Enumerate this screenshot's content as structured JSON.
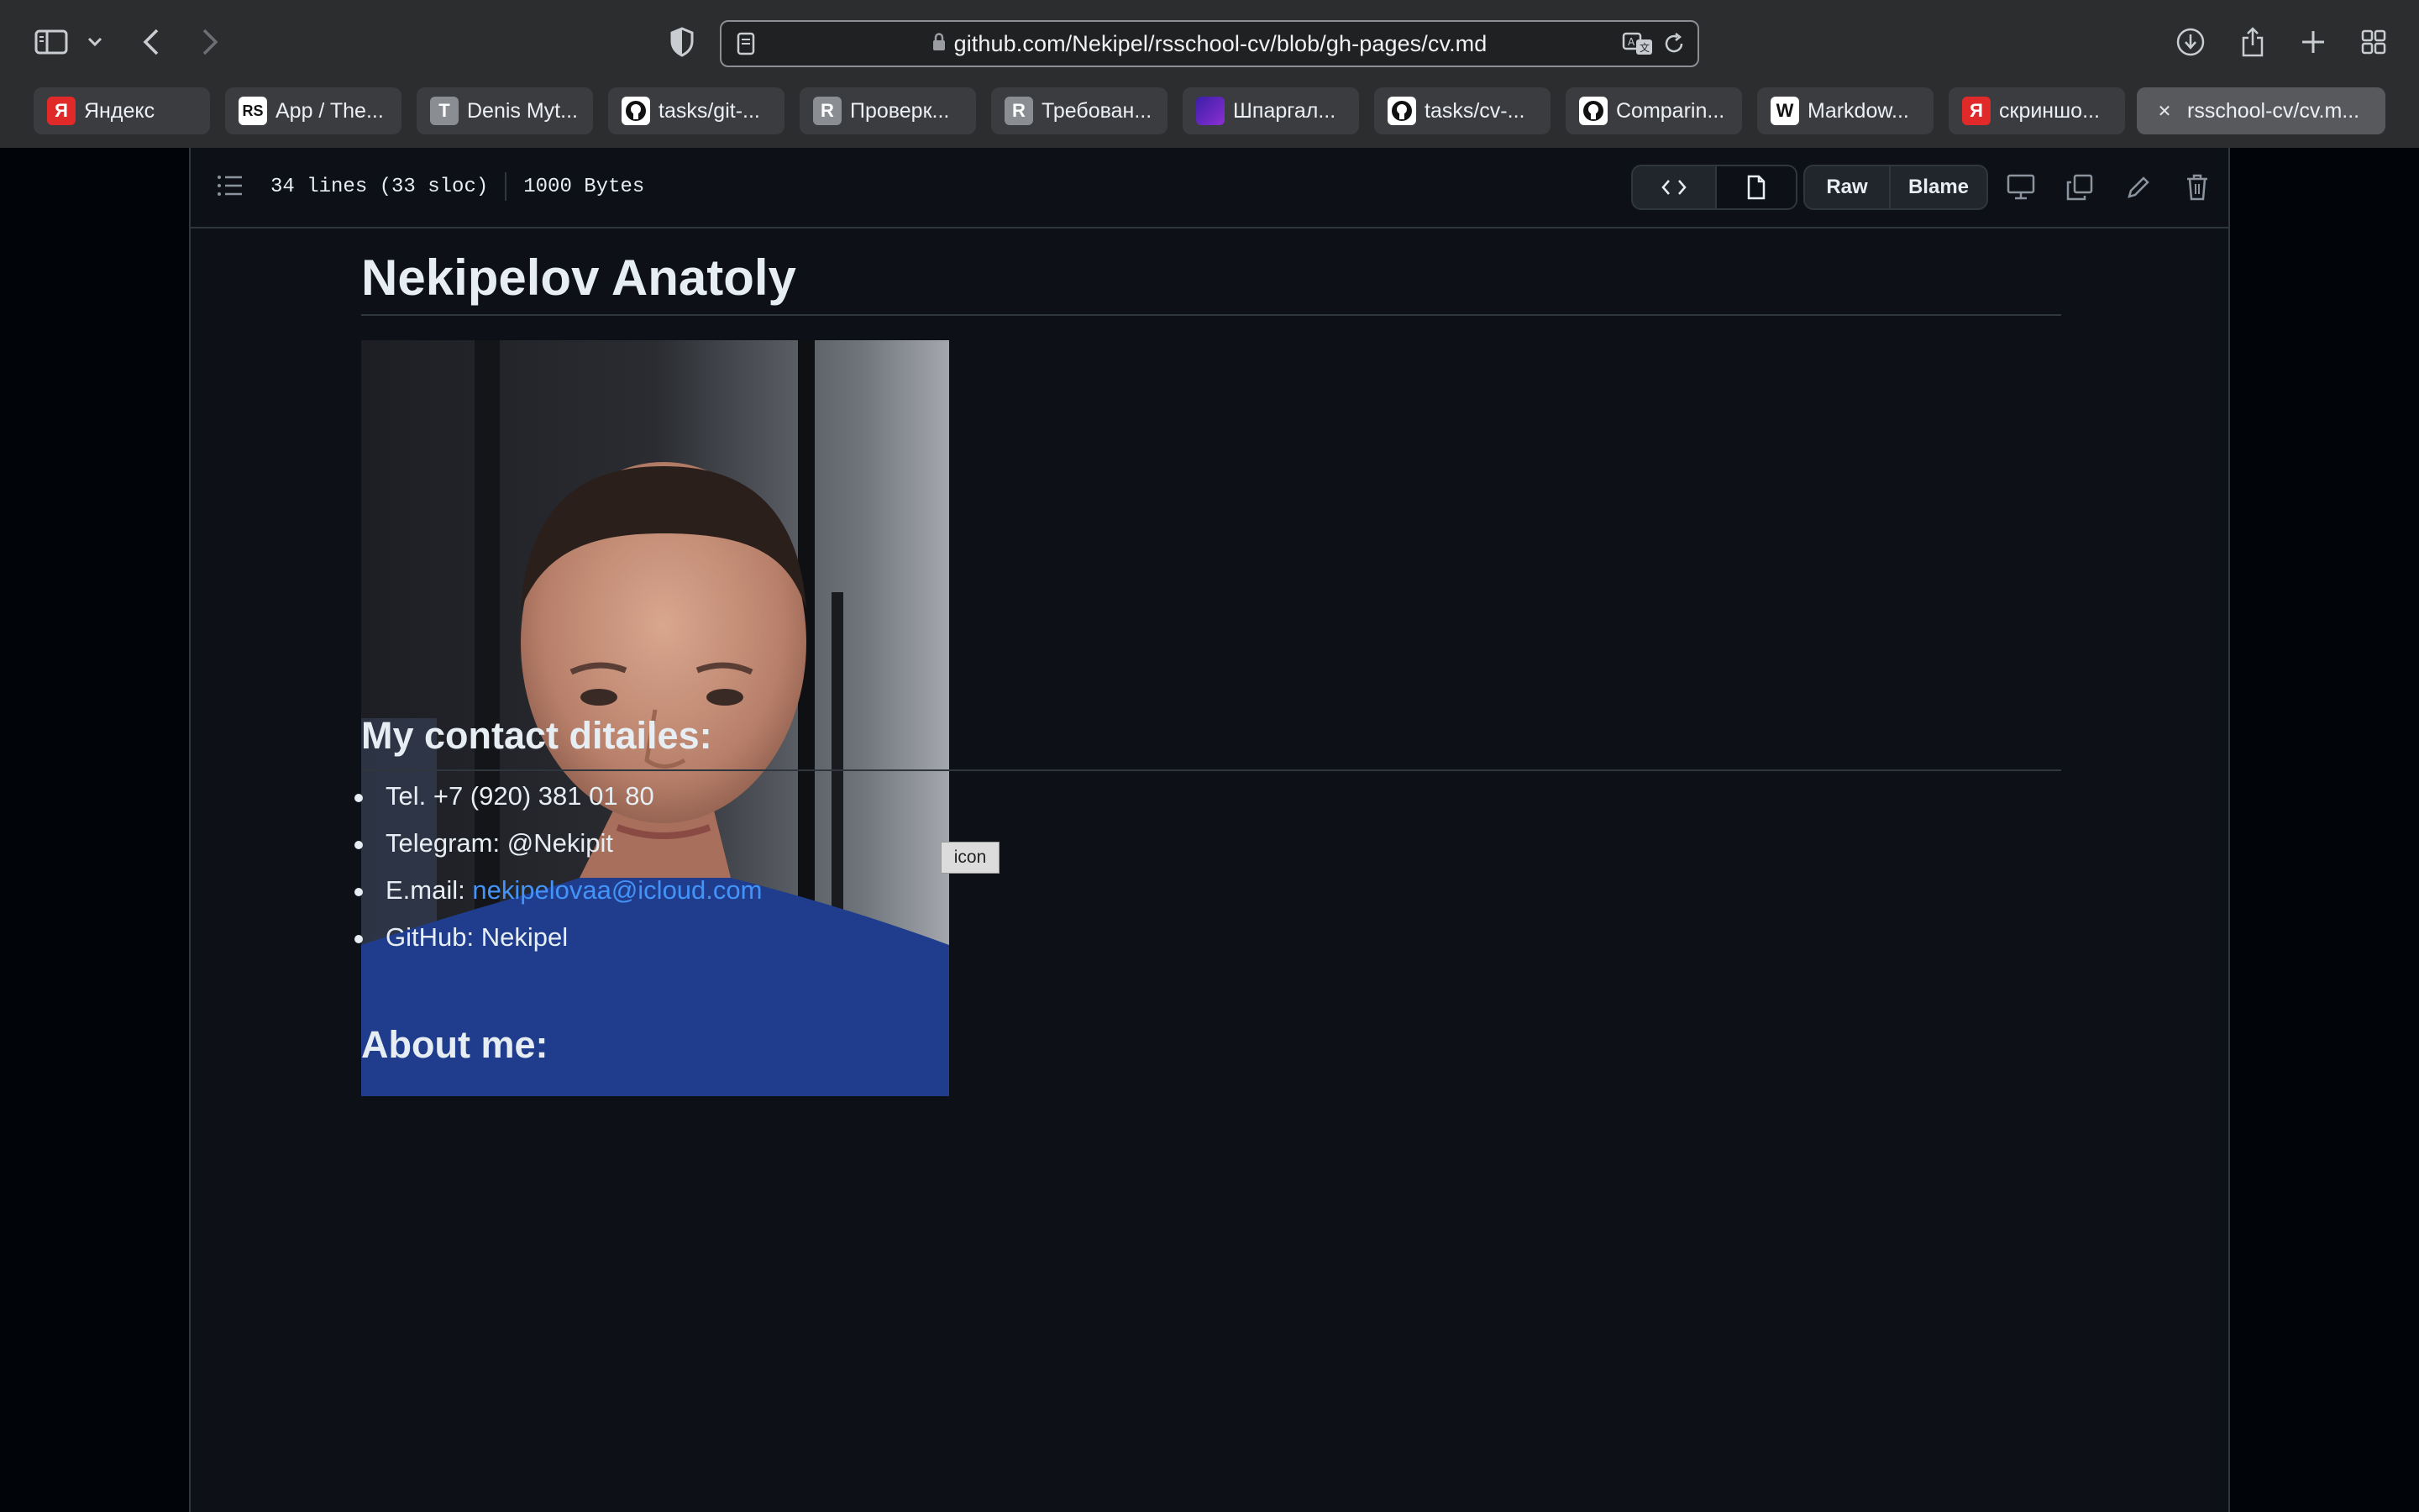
{
  "browser": {
    "url": "github.com/Nekipel/rsschool-cv/blob/gh-pages/cv.md",
    "tabs": [
      {
        "label": "Яндекс",
        "favicon": "yandex-icon",
        "color": "#e02a2a",
        "glyph": "Я"
      },
      {
        "label": "App / The...",
        "favicon": "rs-icon",
        "color": "#ffffff",
        "glyph": "RS"
      },
      {
        "label": "Denis Myt...",
        "favicon": "letter-t-icon",
        "color": "#8a8d92",
        "glyph": "T"
      },
      {
        "label": "tasks/git-...",
        "favicon": "github-icon",
        "color": "#ffffff",
        "glyph": ""
      },
      {
        "label": "Проверк...",
        "favicon": "letter-r-icon",
        "color": "#8a8d92",
        "glyph": "R"
      },
      {
        "label": "Требован...",
        "favicon": "letter-r-icon",
        "color": "#8a8d92",
        "glyph": "R"
      },
      {
        "label": "Шпаргал...",
        "favicon": "purple-square-icon",
        "color": "#6b2fd1",
        "glyph": ""
      },
      {
        "label": "tasks/cv-...",
        "favicon": "github-icon",
        "color": "#ffffff",
        "glyph": ""
      },
      {
        "label": "Comparin...",
        "favicon": "github-icon",
        "color": "#ffffff",
        "glyph": ""
      },
      {
        "label": "Markdow...",
        "favicon": "wikipedia-icon",
        "color": "#ffffff",
        "glyph": "W"
      },
      {
        "label": "скриншо...",
        "favicon": "yandex-icon",
        "color": "#e02a2a",
        "glyph": "Я"
      },
      {
        "label": "rsschool-cv/cv.m...",
        "favicon": "close-tab-icon",
        "color": "#57595d",
        "glyph": "✕",
        "active": true
      }
    ]
  },
  "file_header": {
    "lines_info": "34 lines (33 sloc)",
    "size": "1000 Bytes",
    "raw_label": "Raw",
    "blame_label": "Blame"
  },
  "markdown": {
    "title": "Nekipelov Anatoly",
    "photo_tooltip": "icon",
    "contacts_heading": "My contact ditailes:",
    "contacts": {
      "tel": "Tel. +7 (920) 381 01 80",
      "telegram": "Telegram: @Nekipit",
      "email_label": "E.mail: ",
      "email": "nekipelovaa@icloud.com",
      "github": "GitHub: Nekipel"
    },
    "about_heading": "About me:"
  },
  "colors": {
    "link": "#4493f8",
    "page_bg": "#0d1117",
    "chrome_bg": "#2b2d2f"
  }
}
